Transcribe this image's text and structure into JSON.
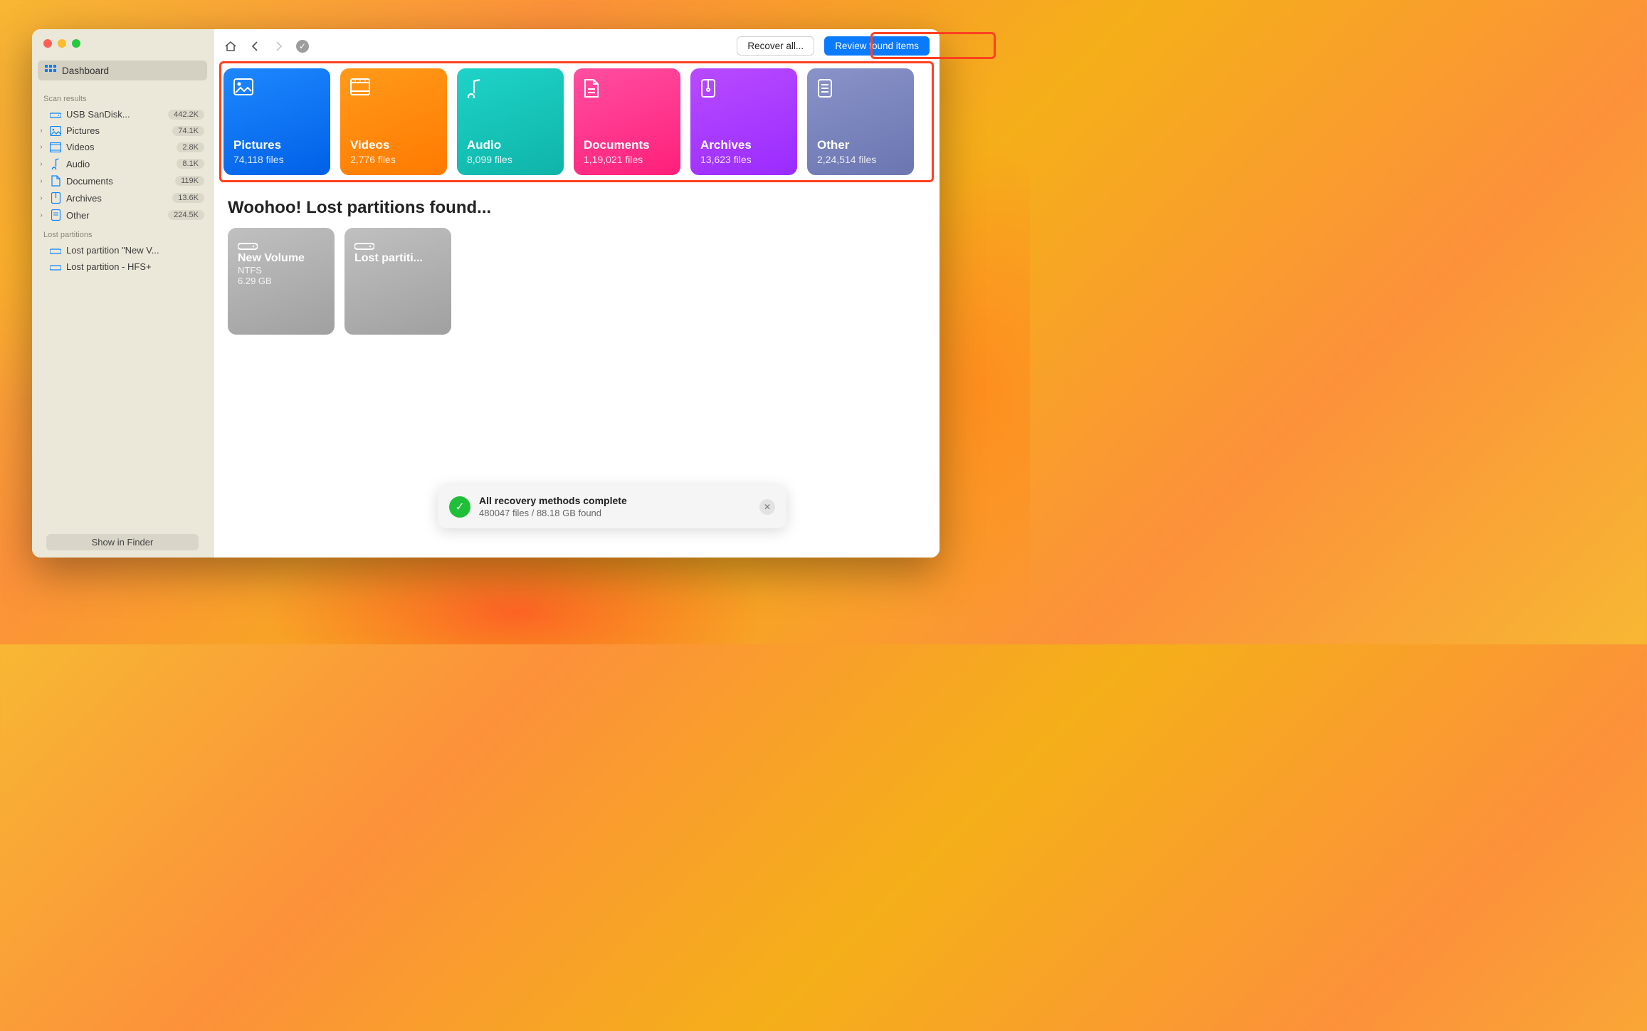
{
  "sidebar": {
    "dashboard_label": "Dashboard",
    "scan_results_header": "Scan results",
    "drive": {
      "label": "USB  SanDisk...",
      "count": "442.2K"
    },
    "categories": [
      {
        "label": "Pictures",
        "count": "74.1K"
      },
      {
        "label": "Videos",
        "count": "2.8K"
      },
      {
        "label": "Audio",
        "count": "8.1K"
      },
      {
        "label": "Documents",
        "count": "119K"
      },
      {
        "label": "Archives",
        "count": "13.6K"
      },
      {
        "label": "Other",
        "count": "224.5K"
      }
    ],
    "lost_partitions_header": "Lost partitions",
    "lost_partitions": [
      {
        "label": "Lost partition \"New V..."
      },
      {
        "label": "Lost partition - HFS+"
      }
    ],
    "show_in_finder": "Show in Finder"
  },
  "toolbar": {
    "recover_all": "Recover all...",
    "review_found": "Review found items"
  },
  "cards": [
    {
      "key": "pictures",
      "title": "Pictures",
      "sub": "74,118 files"
    },
    {
      "key": "videos",
      "title": "Videos",
      "sub": "2,776 files"
    },
    {
      "key": "audio",
      "title": "Audio",
      "sub": "8,099 files"
    },
    {
      "key": "documents",
      "title": "Documents",
      "sub": "1,19,021 files"
    },
    {
      "key": "archives",
      "title": "Archives",
      "sub": "13,623 files"
    },
    {
      "key": "other",
      "title": "Other",
      "sub": "2,24,514 files"
    }
  ],
  "partitions_heading": "Woohoo! Lost partitions found...",
  "partitions": [
    {
      "title": "New Volume",
      "fs": "NTFS",
      "size": "6.29 GB"
    },
    {
      "title": "Lost partiti...",
      "fs": "",
      "size": ""
    }
  ],
  "toast": {
    "title": "All recovery methods complete",
    "subtitle": "480047 files / 88.18 GB found"
  }
}
